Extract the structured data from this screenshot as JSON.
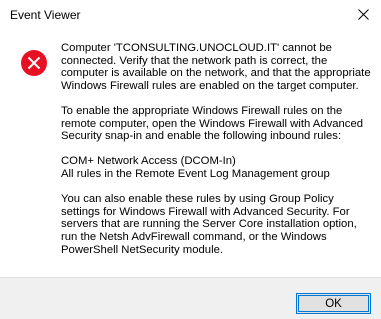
{
  "dialog": {
    "title": "Event Viewer",
    "icon": "error-icon",
    "close_icon": "close-icon",
    "paragraphs": [
      "Computer 'TCONSULTING.UNOCLOUD.IT' cannot be connected. Verify that the network path is correct, the computer is available on the network, and that the appropriate Windows Firewall rules are enabled on the target computer.",
      "To enable the appropriate Windows Firewall rules on the remote computer, open the Windows Firewall with Advanced Security snap-in and enable the following inbound rules:",
      "",
      "You can also enable these rules by using Group Policy settings for Windows Firewall with Advanced Security. For servers that are running the Server Core installation option, run the Netsh AdvFirewall command, or the Windows PowerShell NetSecurity module."
    ],
    "rules": [
      "COM+ Network Access (DCOM-In)",
      "All rules in the Remote Event Log Management group"
    ],
    "ok_label": "OK"
  },
  "colors": {
    "error_red": "#e81123",
    "accent_blue": "#0078d7",
    "footer_bg": "#f0f0f0"
  }
}
